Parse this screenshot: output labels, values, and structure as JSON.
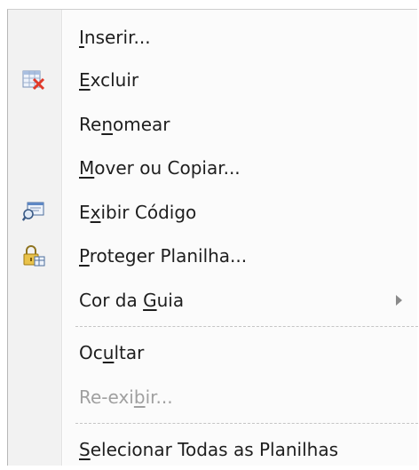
{
  "menu": {
    "items": [
      {
        "pre": "",
        "acc": "I",
        "post": "nserir...",
        "icon": "insert-none",
        "enabled": true
      },
      {
        "pre": "",
        "acc": "E",
        "post": "xcluir",
        "icon": "delete-sheet-icon",
        "enabled": true
      },
      {
        "pre": "Re",
        "acc": "n",
        "post": "omear",
        "icon": "",
        "enabled": true
      },
      {
        "pre": "",
        "acc": "M",
        "post": "over ou Copiar...",
        "icon": "",
        "enabled": true
      },
      {
        "pre": "E",
        "acc": "x",
        "post": "ibir Código",
        "icon": "view-code-icon",
        "enabled": true
      },
      {
        "pre": "",
        "acc": "P",
        "post": "roteger Planilha...",
        "icon": "protect-sheet-icon",
        "enabled": true
      },
      {
        "pre": "Cor da ",
        "acc": "G",
        "post": "uia",
        "icon": "",
        "enabled": true,
        "submenu": true
      },
      {
        "pre": "Oc",
        "acc": "u",
        "post": "ltar",
        "icon": "",
        "enabled": true
      },
      {
        "pre": "Re-exi",
        "acc": "b",
        "post": "ir...",
        "icon": "",
        "enabled": false
      },
      {
        "pre": "",
        "acc": "S",
        "post": "elecionar Todas as Planilhas",
        "icon": "",
        "enabled": true
      }
    ]
  },
  "colors": {
    "gutter": "#f2f2f2",
    "text": "#1e1e1e",
    "disabled_text": "#a0a0a0",
    "delete_x": "#e03a2a"
  }
}
